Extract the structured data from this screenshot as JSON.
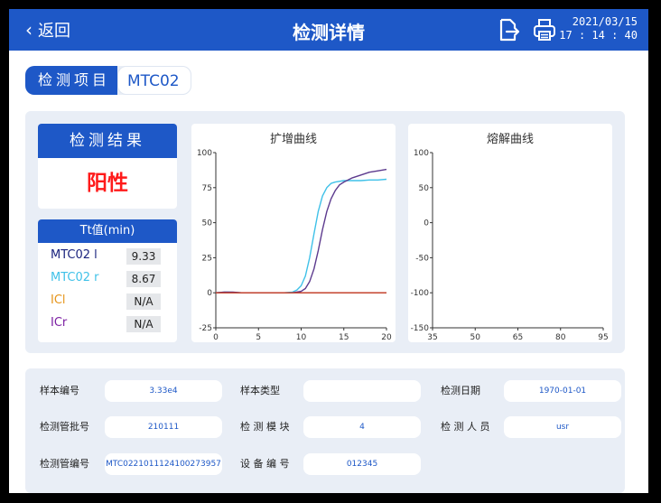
{
  "header": {
    "back_label": "返回",
    "title": "检测详情",
    "date": "2021/03/15",
    "time": "17 : 14 : 40",
    "icons": [
      "export-icon",
      "print-icon"
    ]
  },
  "test_item": {
    "label": "检测项目",
    "value": "MTC02"
  },
  "result": {
    "label": "检测结果",
    "value": "阳性",
    "value_color": "#ff1a1a"
  },
  "tt": {
    "title": "Tt值(min)",
    "rows": [
      {
        "name": "MTC02 l",
        "value": "9.33",
        "color": "#1a237e"
      },
      {
        "name": "MTC02 r",
        "value": "8.67",
        "color": "#3fc1e8"
      },
      {
        "name": "ICl",
        "value": "N/A",
        "color": "#e6951a"
      },
      {
        "name": "ICr",
        "value": "N/A",
        "color": "#7b1fa2"
      }
    ]
  },
  "chart_data": [
    {
      "type": "line",
      "title": "扩增曲线",
      "xlabel": "",
      "ylabel": "",
      "xlim": [
        0,
        20
      ],
      "ylim": [
        -25,
        100
      ],
      "xticks": [
        0,
        5,
        10,
        15,
        20
      ],
      "yticks": [
        100,
        75,
        50,
        25,
        0,
        -25
      ],
      "grid": false,
      "series": [
        {
          "color": "#3fc1e8",
          "x": [
            0,
            1,
            2,
            3,
            4,
            5,
            6,
            7,
            8,
            9,
            9.5,
            10,
            10.5,
            11,
            11.5,
            12,
            12.5,
            13,
            13.5,
            14,
            15,
            16,
            17,
            18,
            19,
            20
          ],
          "y": [
            0,
            0.5,
            0.3,
            0,
            0,
            0,
            0,
            0,
            0,
            0.5,
            2,
            5,
            12,
            25,
            42,
            58,
            69,
            75,
            78,
            79,
            80,
            80,
            80,
            80.5,
            80.5,
            81
          ]
        },
        {
          "color": "#5c3a8e",
          "x": [
            0,
            1,
            2,
            3,
            4,
            5,
            6,
            7,
            8,
            9,
            10,
            10.5,
            11,
            11.5,
            12,
            12.5,
            13,
            13.5,
            14,
            14.5,
            15,
            16,
            17,
            18,
            19,
            20
          ],
          "y": [
            0,
            0.5,
            0.5,
            0,
            0,
            0,
            0,
            0,
            0,
            0,
            1,
            3,
            8,
            17,
            30,
            45,
            58,
            67,
            73,
            77,
            79,
            82,
            84,
            86,
            87,
            88
          ]
        },
        {
          "color": "#e6951a",
          "x": [
            0,
            20
          ],
          "y": [
            0,
            0
          ]
        },
        {
          "color": "#c0392b",
          "x": [
            0,
            20
          ],
          "y": [
            0,
            0
          ]
        }
      ]
    },
    {
      "type": "line",
      "title": "熔解曲线",
      "xlabel": "",
      "ylabel": "",
      "xlim": [
        35,
        95
      ],
      "ylim": [
        -150,
        100
      ],
      "xticks": [
        35,
        50,
        65,
        80,
        95
      ],
      "yticks": [
        100,
        50,
        0,
        -50,
        -100,
        -150
      ],
      "grid": false,
      "series": []
    }
  ],
  "info": {
    "sample_no_label": "样本编号",
    "sample_no": "3.33e4",
    "sample_type_label": "样本类型",
    "sample_type": "",
    "test_date_label": "检测日期",
    "test_date": "1970-01-01",
    "tube_batch_label": "检测管批号",
    "tube_batch": "210111",
    "module_label": "检 测 模 块",
    "module": "4",
    "operator_label": "检 测 人 员",
    "operator": "usr",
    "tube_no_label": "检测管编号",
    "tube_no": "MTC0221011124100273957",
    "device_no_label": "设 备 编 号",
    "device_no": "012345"
  }
}
